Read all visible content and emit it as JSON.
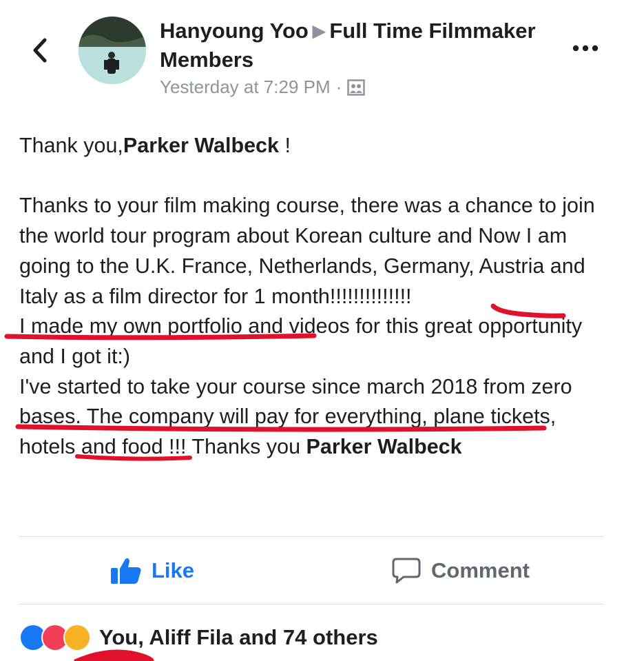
{
  "header": {
    "author_name": "Hanyoung Yoo",
    "group_name": "Full Time Filmmaker Members",
    "timestamp": "Yesterday at 7:29 PM",
    "separator": "·",
    "audience_icon": "group-audience-icon"
  },
  "post": {
    "greeting_prefix": "Thank you,",
    "greeting_name": "Parker Walbeck",
    "greeting_suffix": " !",
    "paragraph": "Thanks to your film making course, there was a chance to join the world tour program about Korean culture and Now I am going to the U.K. France, Netherlands, Germany, Austria and Italy as a film director for 1 month!!!!!!!!!!!!!!",
    "line2": "I made my own  portfolio and videos for this great opportunity and I got it:)",
    "line3": "I've started to take your course since march 2018 from zero bases. The company will pay for everything, plane tickets, hotels and food !!! Thanks you ",
    "closing_name": "Parker Walbeck"
  },
  "actions": {
    "like_label": "Like",
    "comment_label": "Comment"
  },
  "reactions": {
    "summary": "You, Aliff Fila and 74 others",
    "types": [
      "like",
      "love",
      "wow"
    ]
  },
  "colors": {
    "accent": "#1877f2",
    "muted": "#8d949e",
    "annotation": "#e0112b"
  }
}
